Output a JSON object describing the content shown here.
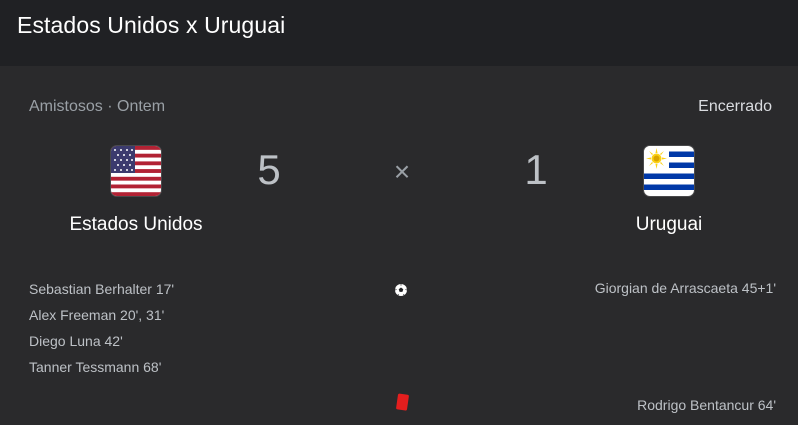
{
  "header": {
    "title": "Estados Unidos x Uruguai"
  },
  "match": {
    "competition": "Amistosos",
    "separator": " · ",
    "date": "Ontem",
    "status": "Encerrado",
    "vs_symbol": "×"
  },
  "home": {
    "name": "Estados Unidos",
    "score": "5",
    "flag_icon": "usa-flag-icon",
    "scorers": [
      "Sebastian Berhalter 17'",
      "Alex Freeman 20', 31'",
      "Diego Luna 42'",
      "Tanner Tessmann 68'"
    ]
  },
  "away": {
    "name": "Uruguai",
    "score": "1",
    "flag_icon": "uruguay-flag-icon",
    "scorers": [
      "Giorgian de Arrascaeta 45+1'"
    ],
    "red_cards": [
      "Rodrigo Bentancur 64'"
    ]
  },
  "icons": {
    "goal": "soccer-ball-icon",
    "red_card": "red-card-icon"
  },
  "colors": {
    "background": "#202124",
    "card": "#2a2a2c",
    "red_card": "#e41e1e"
  }
}
